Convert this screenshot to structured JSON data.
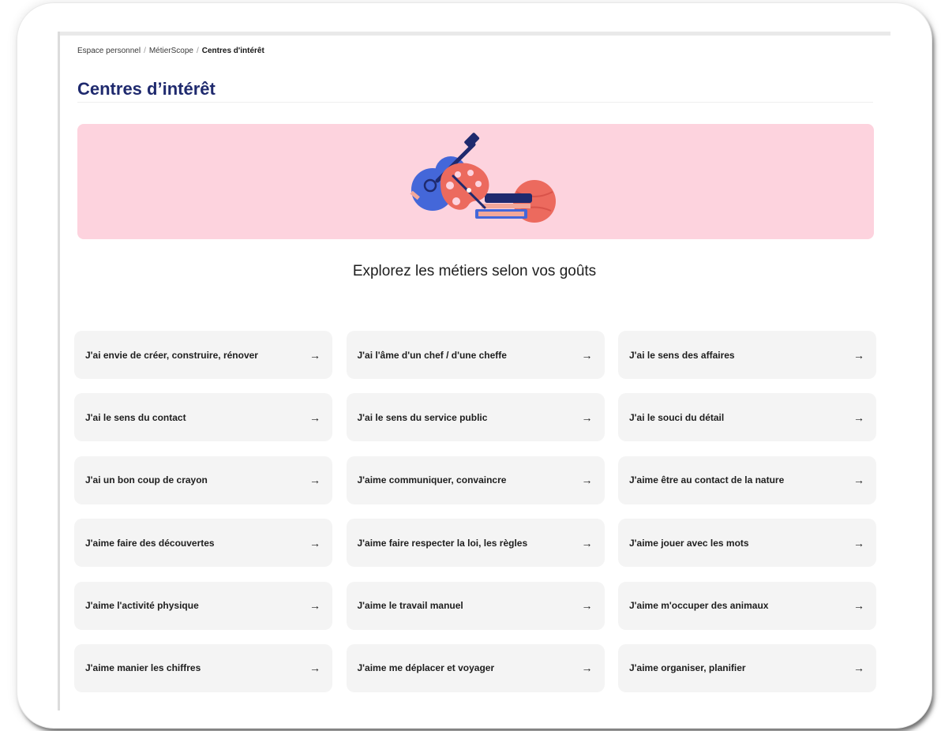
{
  "breadcrumb": {
    "items": [
      "Espace personnel",
      "MétierScope"
    ],
    "current": "Centres d'intérêt"
  },
  "page": {
    "title": "Centres d’intérêt",
    "subtitle": "Explorez les métiers selon vos goûts"
  },
  "banner": {
    "background": "#fdd3de",
    "illustration": "guitar-palette-books-ball-illustration"
  },
  "cards": [
    {
      "label": "J'ai envie de créer, construire, rénover",
      "icon": "arrow-right-icon"
    },
    {
      "label": "J'ai l'âme d'un chef / d'une cheffe",
      "icon": "arrow-right-icon"
    },
    {
      "label": "J'ai le sens des affaires",
      "icon": "arrow-right-icon"
    },
    {
      "label": "J'ai le sens du contact",
      "icon": "arrow-right-icon"
    },
    {
      "label": "J'ai le sens du service public",
      "icon": "arrow-right-icon"
    },
    {
      "label": "J'ai le souci du détail",
      "icon": "arrow-right-icon"
    },
    {
      "label": "J'ai un bon coup de crayon",
      "icon": "arrow-right-icon"
    },
    {
      "label": "J'aime communiquer, convaincre",
      "icon": "arrow-right-icon"
    },
    {
      "label": "J'aime être au contact de la nature",
      "icon": "arrow-right-icon"
    },
    {
      "label": "J'aime faire des découvertes",
      "icon": "arrow-right-icon"
    },
    {
      "label": "J'aime faire respecter la loi, les règles",
      "icon": "arrow-right-icon"
    },
    {
      "label": "J'aime jouer avec les mots",
      "icon": "arrow-right-icon"
    },
    {
      "label": "J'aime l'activité physique",
      "icon": "arrow-right-icon"
    },
    {
      "label": "J'aime le travail manuel",
      "icon": "arrow-right-icon"
    },
    {
      "label": "J'aime m'occuper des animaux",
      "icon": "arrow-right-icon"
    },
    {
      "label": "J'aime manier les chiffres",
      "icon": "arrow-right-icon"
    },
    {
      "label": "J'aime me déplacer et voyager",
      "icon": "arrow-right-icon"
    },
    {
      "label": "J'aime organiser, planifier",
      "icon": "arrow-right-icon"
    }
  ],
  "arrow_glyph": "→",
  "colors": {
    "title": "#1f2a6e",
    "card_background": "#f4f4f4",
    "text": "#1e1e1e"
  }
}
